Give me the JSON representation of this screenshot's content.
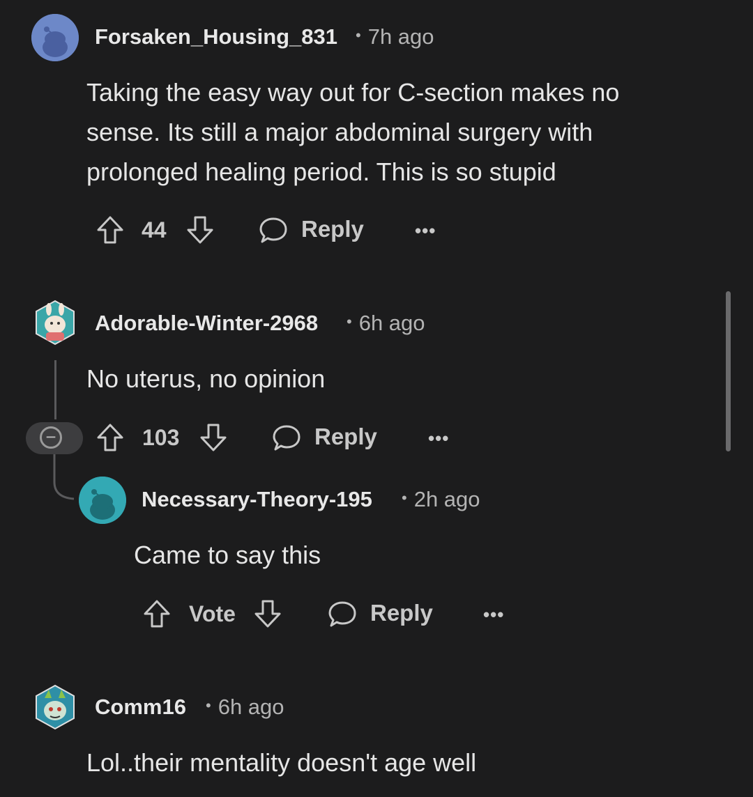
{
  "comments": [
    {
      "username": "Forsaken_Housing_831",
      "time": "7h ago",
      "body": "Taking the easy way out for C-section makes no sense. Its still a major abdominal surgery with prolonged healing period. This is so stupid",
      "votes": "44",
      "reply_label": "Reply",
      "more": "•••",
      "avatar_color": "#6c86c9"
    },
    {
      "username": "Adorable-Winter-2968",
      "time": "6h ago",
      "body": "No uterus, no opinion",
      "votes": "103",
      "reply_label": "Reply",
      "more": "•••",
      "avatar_color": "#3aa6a8"
    },
    {
      "username": "Necessary-Theory-195",
      "time": "2h ago",
      "body": "Came to say this",
      "votes": "Vote",
      "reply_label": "Reply",
      "more": "•••",
      "avatar_color": "#33a9b4"
    },
    {
      "username": "Comm16",
      "time": "6h ago",
      "body": "Lol..their mentality doesn't age well",
      "avatar_color": "#2e8fa6"
    }
  ],
  "collapse_symbol": "−"
}
